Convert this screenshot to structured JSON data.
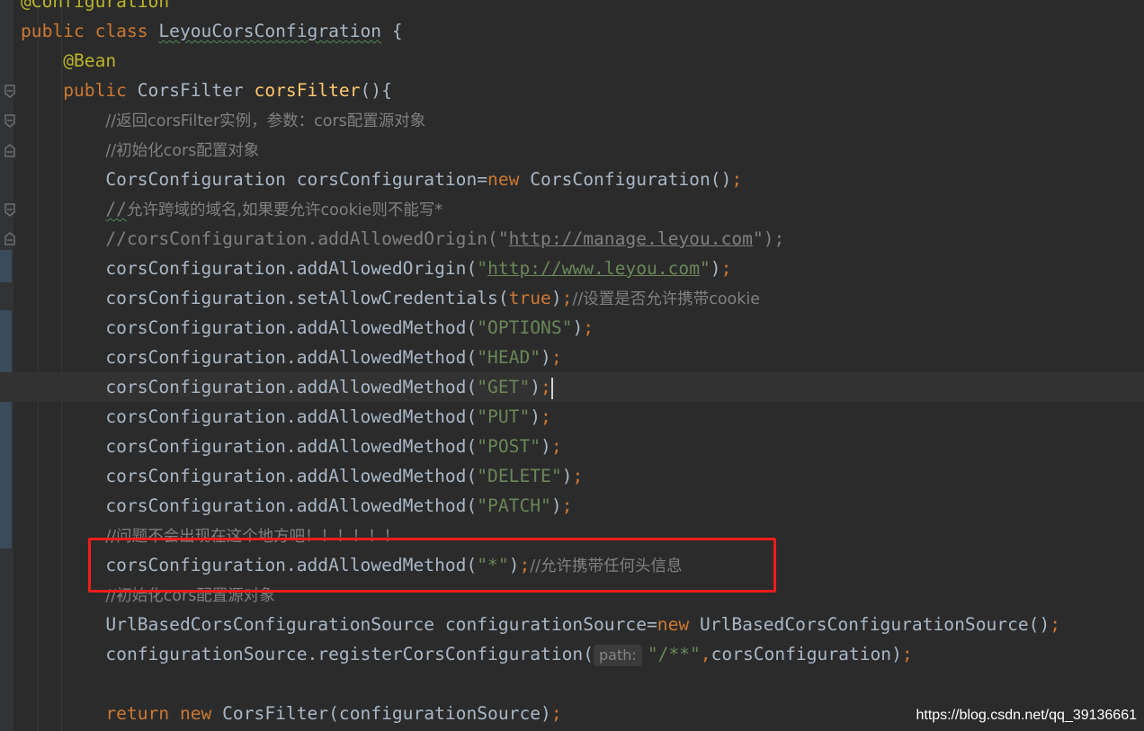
{
  "colors": {
    "background": "#2b2b2b",
    "keyword": "#cc7832",
    "annotation": "#bbb529",
    "method_declaration": "#ffc66d",
    "string": "#6a8759",
    "comment": "#808080",
    "plain": "#a9b7c6",
    "highlight_box": "#f01d1d"
  },
  "code": {
    "l0": {
      "a": "@Configuration"
    },
    "l1": {
      "a": "public class ",
      "b": "LeyouCorsConfigration",
      "c": " {"
    },
    "l2": {
      "a": "@Bean"
    },
    "l3": {
      "a": "public ",
      "b": "CorsFilter ",
      "c": "corsFilter",
      "d": "(){"
    },
    "l4": {
      "a": "//返回corsFilter实例，参数：cors配置源对象"
    },
    "l5": {
      "a": "//初始化cors配置对象"
    },
    "l6": {
      "a": "CorsConfiguration corsConfiguration=",
      "b": "new ",
      "c": "CorsConfiguration()",
      "d": ";"
    },
    "l7": {
      "a": "//",
      "b": "允许跨域的域名,如果要允许cookie则不能写*"
    },
    "l8": {
      "a": "//corsConfiguration.addAllowedOrigin(\"",
      "b": "http://manage.leyou.com",
      "c": "\");"
    },
    "l9": {
      "a": "corsConfiguration.addAllowedOrigin(",
      "b": "\"",
      "c": "http://www.leyou.com",
      "d": "\"",
      "e": ")",
      "f": ";"
    },
    "l10": {
      "a": "corsConfiguration.setAllowCredentials(",
      "b": "true",
      "c": ")",
      "d": ";",
      "e": "//设置是否允许携带cookie"
    },
    "l11": {
      "a": "corsConfiguration.addAllowedMethod(",
      "b": "\"OPTIONS\"",
      "c": ")",
      "d": ";"
    },
    "l12": {
      "a": "corsConfiguration.addAllowedMethod(",
      "b": "\"HEAD\"",
      "c": ")",
      "d": ";"
    },
    "l13": {
      "a": "corsConfiguration.addAllowedMethod(",
      "b": "\"GET\"",
      "c": ")",
      "d": ";"
    },
    "l14": {
      "a": "corsConfiguration.addAllowedMethod(",
      "b": "\"PUT\"",
      "c": ")",
      "d": ";"
    },
    "l15": {
      "a": "corsConfiguration.addAllowedMethod(",
      "b": "\"POST\"",
      "c": ")",
      "d": ";"
    },
    "l16": {
      "a": "corsConfiguration.addAllowedMethod(",
      "b": "\"DELETE\"",
      "c": ")",
      "d": ";"
    },
    "l17": {
      "a": "corsConfiguration.addAllowedMethod(",
      "b": "\"PATCH\"",
      "c": ")",
      "d": ";"
    },
    "l18": {
      "a": "//问题不会出现在这个地方吧！！！！！！"
    },
    "l19": {
      "a": "corsConfiguration.addAllowedMethod(",
      "b": "\"*\"",
      "c": ")",
      "d": ";",
      "e": "//允许携带任何头信息"
    },
    "l20": {
      "a": "//初始化cors配置源对象"
    },
    "l21": {
      "a": "UrlBasedCorsConfigurationSource configurationSource=",
      "b": "new ",
      "c": "UrlBasedCorsConfigurationSource()",
      "d": ";"
    },
    "l22": {
      "a": "configurationSource.registerCorsConfiguration(",
      "hint": "path:",
      "b": "\"/**\"",
      "c": ",",
      "d": "corsConfiguration)",
      "e": ";"
    },
    "l24": {
      "a": "return new ",
      "b": "CorsFilter(configurationSource)",
      "c": ";"
    }
  },
  "watermark": "https://blog.csdn.net/qq_39136661"
}
